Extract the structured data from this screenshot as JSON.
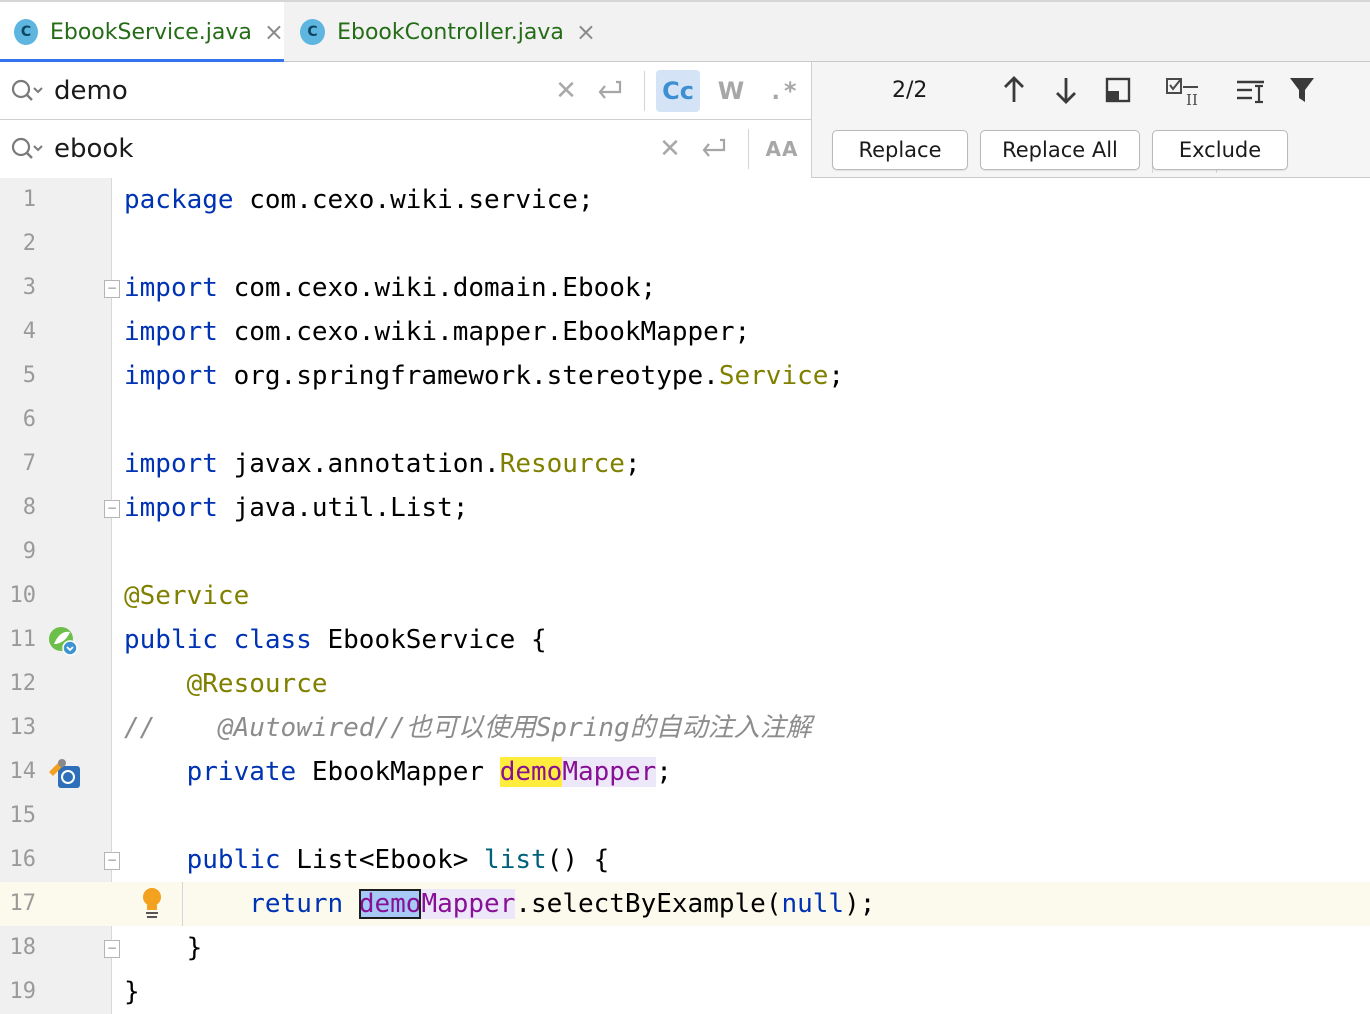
{
  "tabs": [
    {
      "icon": "C",
      "label": "EbookService.java",
      "active": true
    },
    {
      "icon": "C",
      "label": "EbookController.java",
      "active": false
    }
  ],
  "find": {
    "query": "demo",
    "replacement": "ebook",
    "match_case": "Cc",
    "words": "W",
    "regex": ".*",
    "preserve_case": "AA",
    "match_count": "2/2",
    "replace_label": "Replace",
    "replace_all_label": "Replace All",
    "exclude_label": "Exclude"
  },
  "editor": {
    "current_line": 17,
    "lines": [
      {
        "n": "1"
      },
      {
        "n": "2"
      },
      {
        "n": "3"
      },
      {
        "n": "4"
      },
      {
        "n": "5"
      },
      {
        "n": "6"
      },
      {
        "n": "7"
      },
      {
        "n": "8"
      },
      {
        "n": "9"
      },
      {
        "n": "10"
      },
      {
        "n": "11"
      },
      {
        "n": "12"
      },
      {
        "n": "13"
      },
      {
        "n": "14"
      },
      {
        "n": "15"
      },
      {
        "n": "16"
      },
      {
        "n": "17"
      },
      {
        "n": "18"
      },
      {
        "n": "19"
      }
    ],
    "code": {
      "l1_kw": "package",
      "l1_rest": " com.cexo.wiki.service;",
      "l3_kw": "import",
      "l3_rest": " com.cexo.wiki.domain.Ebook;",
      "l4_kw": "import",
      "l4_rest": " com.cexo.wiki.mapper.EbookMapper;",
      "l5_kw": "import",
      "l5_rest": " org.springframework.stereotype.",
      "l5_ann": "Service",
      "l5_end": ";",
      "l7_kw": "import",
      "l7_rest": " javax.annotation.",
      "l7_ann": "Resource",
      "l7_end": ";",
      "l8_kw": "import",
      "l8_rest": " java.util.List;",
      "l10_ann": "@Service",
      "l11_kw": "public class",
      "l11_rest": " EbookService {",
      "l12_ann": "@Resource",
      "l13_cmt": "//    @Autowired//也可以使用Spring的自动注入注解",
      "l14_kw": "private",
      "l14_rest": " EbookMapper ",
      "l14_demo": "demo",
      "l14_mapper": "Mapper",
      "l14_end": ";",
      "l16_kw": "public",
      "l16_rest": " List<Ebook> ",
      "l16_method": "list",
      "l16_end": "() {",
      "l17_kw": "return",
      "l17_demo": "demo",
      "l17_mapper": "Mapper",
      "l17_rest": ".selectByExample(",
      "l17_null": "null",
      "l17_end": ");",
      "l18": "}",
      "l19": "}"
    }
  },
  "icons": {
    "search": "search-icon",
    "clear": "clear-icon",
    "newline": "newline-icon",
    "prev": "arrow-up-icon",
    "next": "arrow-down-icon",
    "in_selection": "search-in-selection-icon",
    "multi_select": "select-all-occurrences-icon",
    "filter_settings": "search-settings-icon",
    "filter": "filter-icon",
    "bean": "spring-bean-icon",
    "inject": "autowired-icon",
    "bulb": "intention-bulb-icon"
  },
  "colors": {
    "keyword": "#0033b3",
    "annotation": "#808000",
    "field": "#871094",
    "comment": "#8c8c8c",
    "match_highlight": "#ffec3d",
    "tab_accent": "#3574f0"
  }
}
